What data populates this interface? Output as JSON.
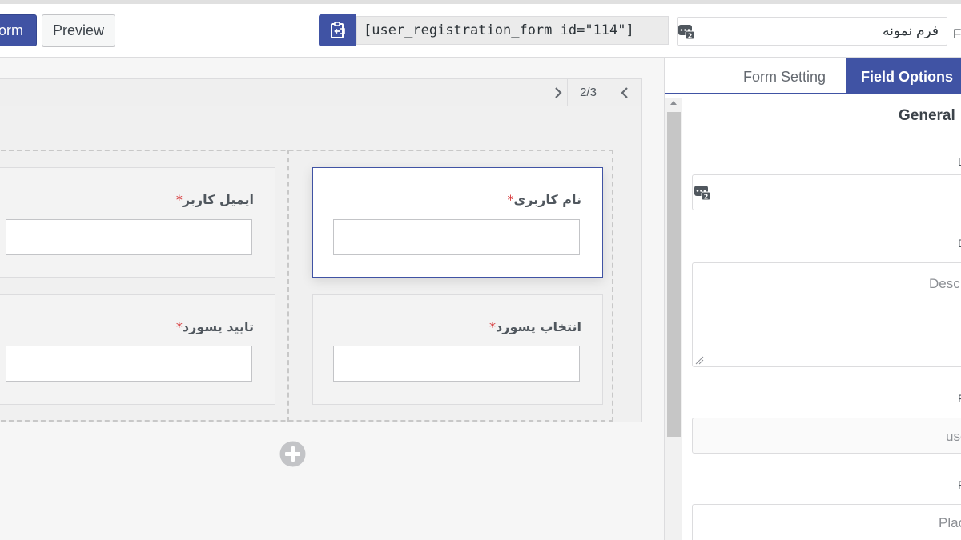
{
  "toolbar": {
    "update_label": "Form",
    "update_visible": "orm",
    "preview_label": "Preview",
    "shortcode": "[user_registration_form id=\"114\"]",
    "form_title_value": "فرم نمونه",
    "form_title_label_fragment": "F"
  },
  "builder": {
    "pager": {
      "count": "2/3"
    },
    "fields": [
      {
        "label": "نام کاربری",
        "required": "*"
      },
      {
        "label": "ایمیل کاربر",
        "required": "*"
      },
      {
        "label": "انتخاب پسورد",
        "required": "*"
      },
      {
        "label": "تایید پسورد",
        "required": "*"
      }
    ]
  },
  "sidebar": {
    "tabs": [
      {
        "label": "Form Setting"
      },
      {
        "label": "Field Options"
      }
    ],
    "section_title": "General",
    "description_placeholder": "Desc",
    "field_name_value": "use",
    "placeholder_fragment": "Plac",
    "label_fragments": [
      "L",
      "D",
      "F",
      "P"
    ]
  },
  "colors": {
    "accent": "#4053a4",
    "required": "#d63638"
  },
  "icons": [
    "clipboard-icon",
    "field-id-badge-icon",
    "chevron-right-icon",
    "chevron-left-icon",
    "add-circle-icon",
    "resize-handle-icon"
  ]
}
